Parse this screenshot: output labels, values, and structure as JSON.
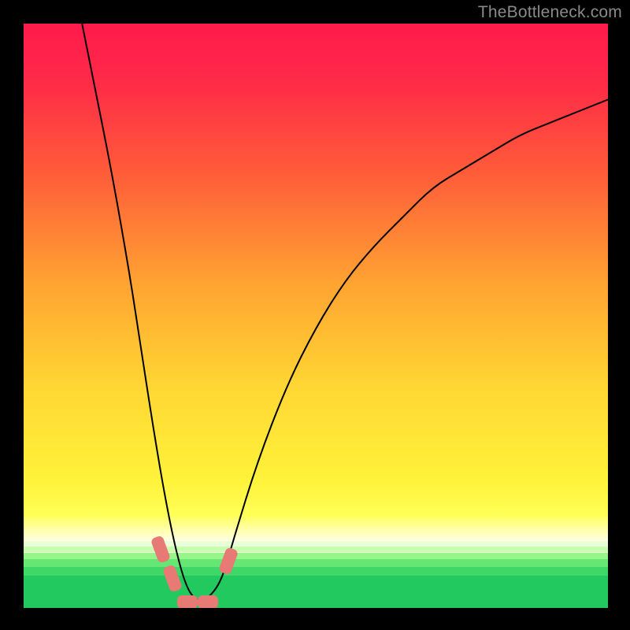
{
  "watermark": "TheBottleneck.com",
  "colors": {
    "frame": "#000000",
    "gradient_stops": [
      {
        "pct": 0,
        "color": "#ff1a4d"
      },
      {
        "pct": 10,
        "color": "#ff2a47"
      },
      {
        "pct": 25,
        "color": "#ff5a3a"
      },
      {
        "pct": 45,
        "color": "#ffa531"
      },
      {
        "pct": 62,
        "color": "#ffd633"
      },
      {
        "pct": 78,
        "color": "#fff23a"
      },
      {
        "pct": 84,
        "color": "#ffff55"
      },
      {
        "pct": 86.5,
        "color": "#ffffa8"
      },
      {
        "pct": 88.5,
        "color": "#ffffe2"
      }
    ],
    "green_bands": [
      {
        "top_pct": 88.5,
        "h_pct": 1.0,
        "color": "#e8ffd8"
      },
      {
        "top_pct": 89.5,
        "h_pct": 1.0,
        "color": "#c8ffb0"
      },
      {
        "top_pct": 90.5,
        "h_pct": 1.2,
        "color": "#98f58a"
      },
      {
        "top_pct": 91.7,
        "h_pct": 1.3,
        "color": "#66e675"
      },
      {
        "top_pct": 93.0,
        "h_pct": 1.5,
        "color": "#3fd768"
      },
      {
        "top_pct": 94.5,
        "h_pct": 5.5,
        "color": "#21c95f"
      }
    ],
    "curve": "#000000",
    "marker": "#e77a74"
  },
  "chart_data": {
    "type": "line",
    "title": "",
    "xlabel": "",
    "ylabel": "",
    "xlim": [
      0,
      100
    ],
    "ylim": [
      0,
      100
    ],
    "note": "Single V-shaped curve; y≈100 is top (bad), y≈0 is bottom (good). Minimum around x≈28–32. Values are visual estimates from the image (no axis ticks present).",
    "series": [
      {
        "name": "bottleneck-curve",
        "x": [
          10,
          12,
          15,
          18,
          20,
          22,
          24,
          26,
          28,
          30,
          32,
          34,
          36,
          40,
          45,
          50,
          55,
          60,
          65,
          70,
          75,
          80,
          85,
          90,
          95,
          100
        ],
        "y": [
          100,
          90,
          75,
          58,
          45,
          32,
          20,
          10,
          3,
          1,
          2,
          5,
          12,
          25,
          38,
          48,
          56,
          62,
          67,
          72,
          75,
          78,
          81,
          83,
          85,
          87
        ]
      }
    ],
    "markers": [
      {
        "x": 23.5,
        "y": 10,
        "w": 2.2,
        "h": 4.5,
        "rot": -20
      },
      {
        "x": 25.5,
        "y": 5,
        "w": 2.2,
        "h": 4.5,
        "rot": -20
      },
      {
        "x": 28.0,
        "y": 1,
        "w": 3.5,
        "h": 2.2,
        "rot": 0
      },
      {
        "x": 31.5,
        "y": 1,
        "w": 3.5,
        "h": 2.2,
        "rot": 0
      },
      {
        "x": 35.0,
        "y": 8,
        "w": 2.2,
        "h": 4.5,
        "rot": 20
      }
    ]
  }
}
